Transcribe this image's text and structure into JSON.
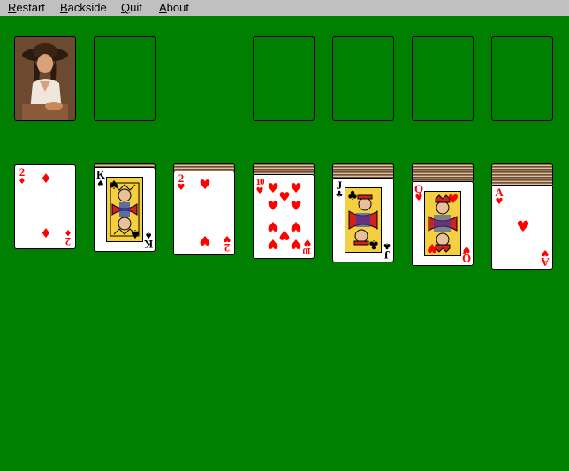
{
  "menu": {
    "restart": {
      "acc": "R",
      "rest": "estart"
    },
    "backside": {
      "acc": "B",
      "rest": "ackside"
    },
    "quit": {
      "acc": "Q",
      "rest": "uit"
    },
    "about": {
      "acc": "A",
      "rest": "bout"
    }
  },
  "colors": {
    "table": "#007f00",
    "menubar": "#c0c0c0",
    "red_suit": "#ff0000",
    "black_suit": "#000000"
  },
  "stock": {
    "label": "deck-back-photo"
  },
  "tableau": [
    {
      "rank": "2",
      "suit": "♦",
      "suit_name": "diamonds",
      "color": "red",
      "hidden_cards": 0
    },
    {
      "rank": "K",
      "suit": "♠",
      "suit_name": "spades",
      "color": "black",
      "hidden_cards": 1
    },
    {
      "rank": "2",
      "suit": "♥",
      "suit_name": "hearts",
      "color": "red",
      "hidden_cards": 2
    },
    {
      "rank": "10",
      "suit": "♥",
      "suit_name": "hearts",
      "color": "red",
      "hidden_cards": 3
    },
    {
      "rank": "J",
      "suit": "♣",
      "suit_name": "clubs",
      "color": "black",
      "hidden_cards": 4
    },
    {
      "rank": "Q",
      "suit": "♥",
      "suit_name": "hearts",
      "color": "red",
      "hidden_cards": 5
    },
    {
      "rank": "A",
      "suit": "♥",
      "suit_name": "hearts",
      "color": "red",
      "hidden_cards": 6
    }
  ]
}
